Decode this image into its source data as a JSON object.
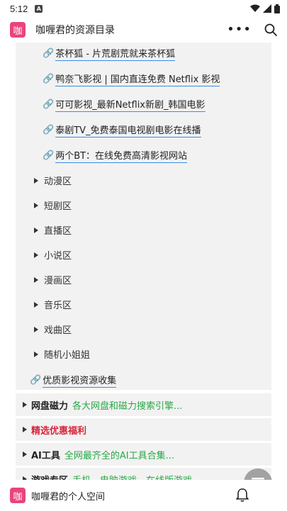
{
  "status_bar": {
    "time": "5:12",
    "notification_badge": "A",
    "icons": [
      "wifi-icon",
      "signal-icon",
      "battery-icon"
    ]
  },
  "header": {
    "logo_text": "咖",
    "title": "咖喱君的资源目录",
    "more_icon": "more-dots-icon",
    "search_icon": "search-icon"
  },
  "links": [
    {
      "label": "茶杯狐 - 片荒剧荒就来茶杯狐"
    },
    {
      "label": "鸭奈飞影视 | 国内直连免费 Netflix 影视"
    },
    {
      "label": "可可影视_最新Netflix新剧_韩国电影"
    },
    {
      "label": "泰剧TV_免费泰国电视剧电影在线播"
    },
    {
      "label": "两个BT：在线免费高清影视网站"
    }
  ],
  "categories": [
    "动漫区",
    "短剧区",
    "直播区",
    "小说区",
    "漫画区",
    "音乐区",
    "戏曲区",
    "随机小姐姐"
  ],
  "collection_link": {
    "label": "优质影视资源收集"
  },
  "sections": [
    {
      "name": "网盘磁力",
      "desc": "各大网盘和磁力搜索引擎...",
      "name_color": "#222222"
    },
    {
      "name": "精选优惠福利",
      "desc": "",
      "name_color": "#d7263d"
    },
    {
      "name": "AI工具",
      "desc": "全网最齐全的AI工具合集...",
      "name_color": "#222222"
    },
    {
      "name": "游戏专区",
      "desc": "手机、电脑游戏、在线版游戏...",
      "name_color": "#222222"
    }
  ],
  "colors": {
    "accent": "#e8457a",
    "link_underline": "#3b8de0",
    "desc_green": "#27a844",
    "panel_bg": "#f2f2f2"
  },
  "bottom_bar": {
    "logo_text": "咖",
    "title": "咖喱君的个人空间",
    "bell_icon": "bell-icon",
    "user_icon": "user-icon"
  },
  "fab": {
    "icon": "menu-icon"
  }
}
